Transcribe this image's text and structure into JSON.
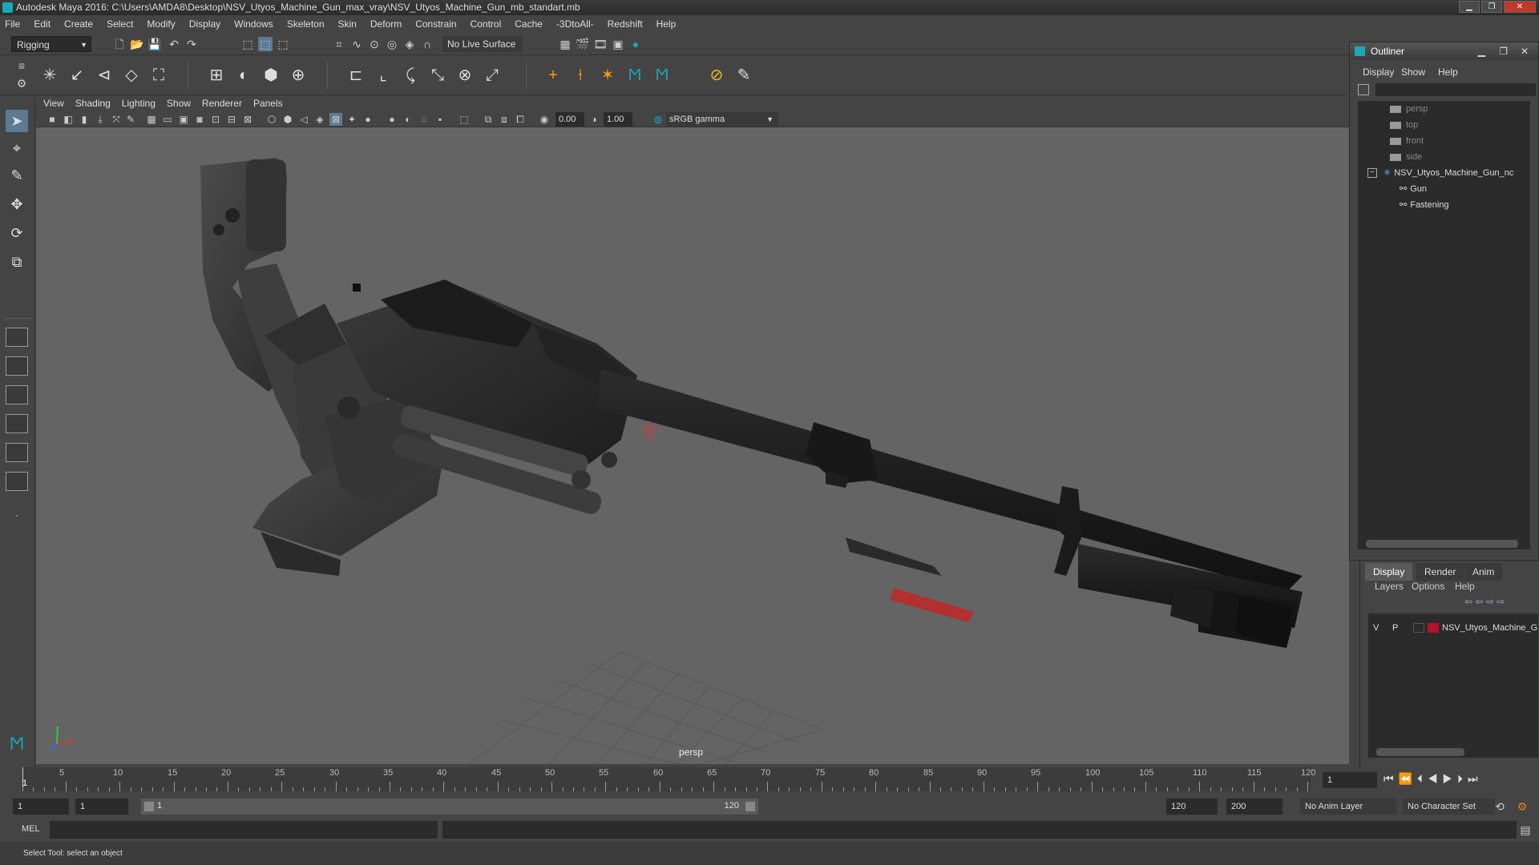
{
  "window": {
    "title": "Autodesk Maya 2016: C:\\Users\\AMDA8\\Desktop\\NSV_Utyos_Machine_Gun_max_vray\\NSV_Utyos_Machine_Gun_mb_standart.mb",
    "controls": [
      "▁",
      "❐",
      "✕"
    ]
  },
  "menubar": {
    "items": [
      "File",
      "Edit",
      "Create",
      "Select",
      "Modify",
      "Display",
      "Windows",
      "Skeleton",
      "Skin",
      "Deform",
      "Constrain",
      "Control",
      "Cache",
      "-3DtoAll-",
      "Redshift",
      "Help"
    ]
  },
  "statusline": {
    "menuset": "Rigging",
    "live_surface": "No Live Surface"
  },
  "viewport": {
    "menu": [
      "View",
      "Shading",
      "Lighting",
      "Show",
      "Renderer",
      "Panels"
    ],
    "exposure": "0.00",
    "gamma": "1.00",
    "color_space": "sRGB gamma",
    "camera_label": "persp"
  },
  "outliner": {
    "title": "Outliner",
    "menu": [
      "Display",
      "Show",
      "Help"
    ],
    "controls": [
      "▁",
      "❐",
      "✕"
    ],
    "cameras": [
      "persp",
      "top",
      "front",
      "side"
    ],
    "root": "NSV_Utyos_Machine_Gun_nc",
    "root_expander": "−",
    "children": [
      "Gun",
      "Fastening"
    ]
  },
  "layer_editor": {
    "tabs": [
      "Display",
      "Render",
      "Anim"
    ],
    "menu": [
      "Layers",
      "Options",
      "Help"
    ],
    "layer": {
      "v": "V",
      "p": "P",
      "name": "NSV_Utyos_Machine_G",
      "color": "#b5122b"
    }
  },
  "timeline": {
    "ticks": [
      "5",
      "10",
      "15",
      "20",
      "25",
      "30",
      "35",
      "40",
      "45",
      "50",
      "55",
      "60",
      "65",
      "70",
      "75",
      "80",
      "85",
      "90",
      "95",
      "100",
      "105",
      "110",
      "115",
      "120"
    ],
    "current_frame": "1",
    "frame_field": "1"
  },
  "range": {
    "start": "1",
    "start2": "1",
    "slider_start": "1",
    "slider_end": "120",
    "end": "120",
    "end2": "200",
    "anim_layer": "No Anim Layer",
    "character_set": "No Character Set"
  },
  "cmdline": {
    "label": "MEL"
  },
  "helpline": {
    "text": "Select Tool: select an object"
  },
  "colors": {
    "accent": "#1aa7b8",
    "active_tool": "#5d7a92",
    "layer_red": "#b5122b"
  }
}
